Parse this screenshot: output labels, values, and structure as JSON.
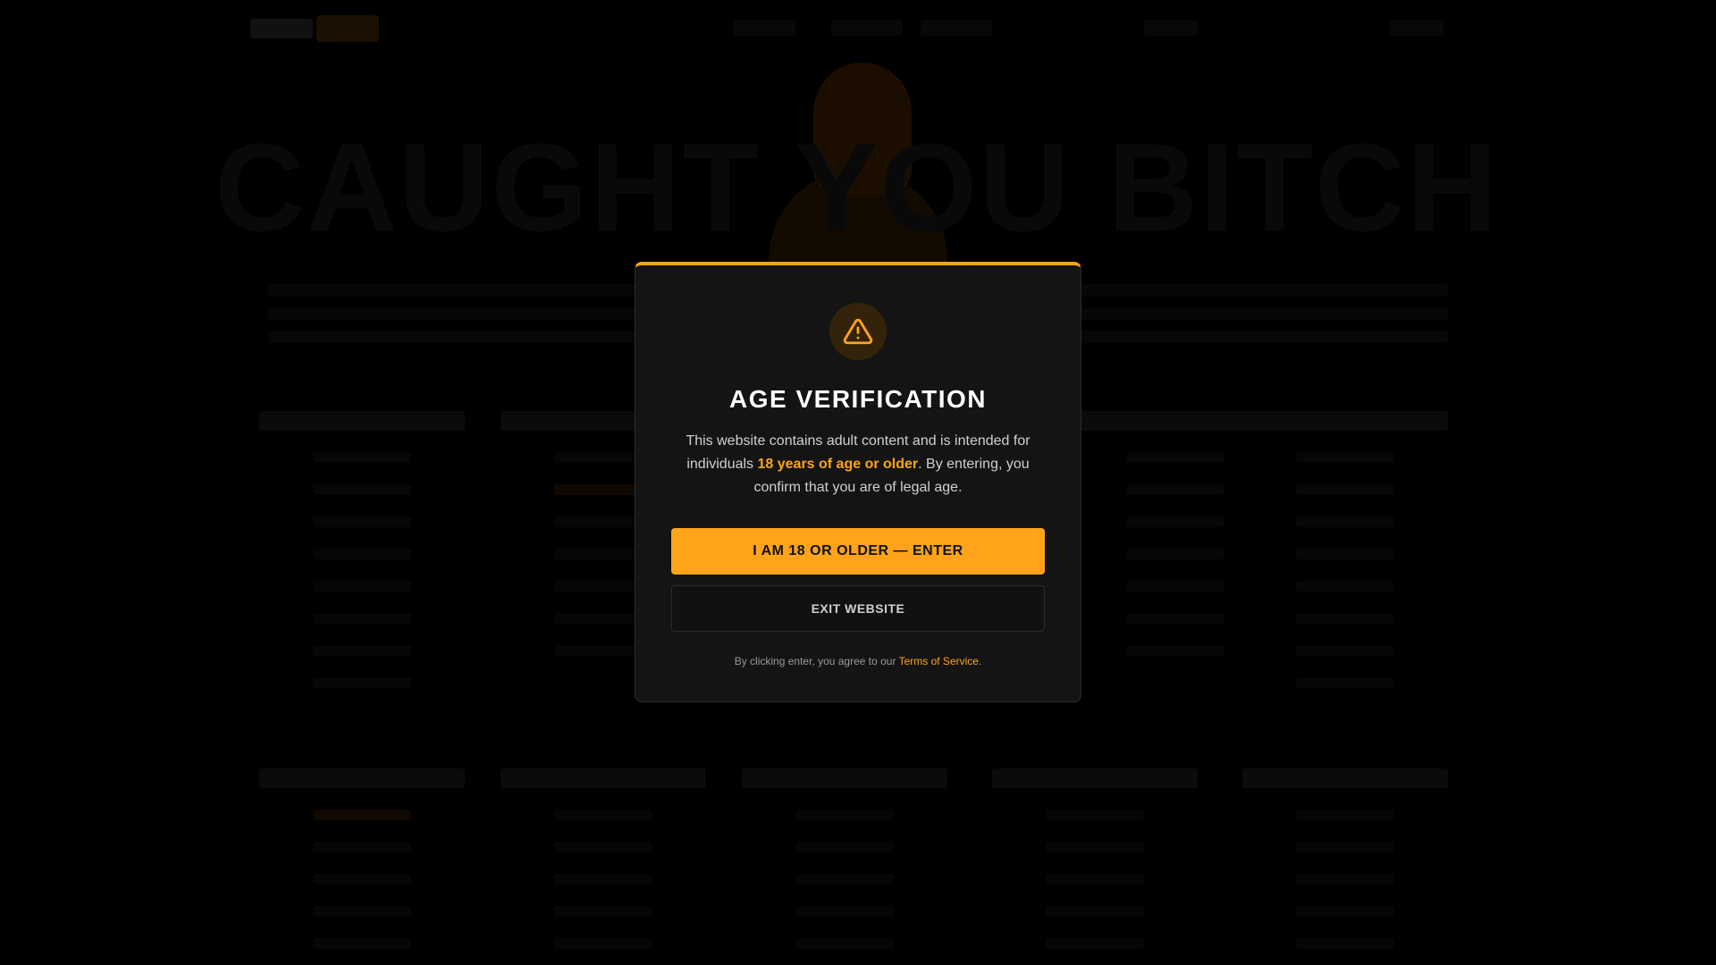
{
  "background": {
    "headline": "CAUGHT YOU BITCH"
  },
  "modal": {
    "icon": "warning-triangle-icon",
    "title": "AGE VERIFICATION",
    "text_before": "This website contains adult content and is intended for individuals ",
    "text_highlight": "18 years of age or older",
    "text_after": ". By entering, you confirm that you are of legal age.",
    "enter_label": "I AM 18 OR OLDER — ENTER",
    "exit_label": "EXIT WEBSITE",
    "terms_before": "By clicking enter, you agree to our ",
    "terms_link": "Terms of Service",
    "terms_after": "."
  },
  "colors": {
    "accent": "#ffa31a",
    "modal_bg": "#141414",
    "page_bg": "#000000"
  }
}
